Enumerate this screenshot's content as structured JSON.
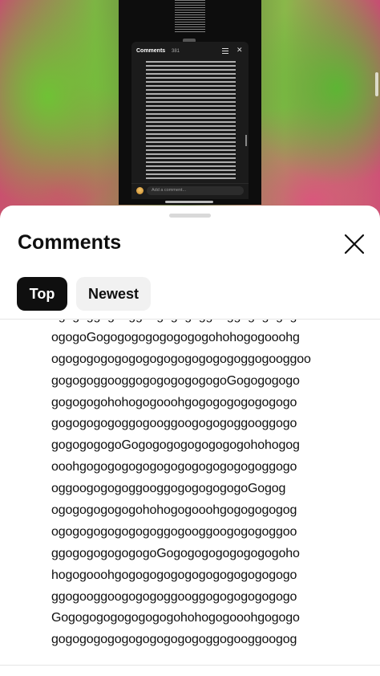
{
  "video": {
    "mini_sheet": {
      "title": "Comments",
      "count": "381",
      "input_placeholder": "Add a comment..."
    }
  },
  "sheet": {
    "title": "Comments",
    "tabs": [
      {
        "label": "Top",
        "selected": true
      },
      {
        "label": "Newest",
        "selected": false
      }
    ],
    "comment_lines": [
      "ogogoggogooggoogogogoggooggogogogog",
      "ogogoGogogogogogogogogohohogogooohg",
      "ogogogogogogogogogogogogogoggogooggoo",
      "gogogoggooggogogogogogogoGogogogogo",
      "gogogogohohogogooohgogogogogogogogo",
      "gogogogogoggogooggoogogogoggooggogo",
      "gogogogogoGogogogogogogogogohohogog",
      "ooohgogogogogogogogogogogogogoggogo",
      "oggoogogogoggooggogogogogogoGogog",
      "ogogogogogogohohogogooohgogogogogog",
      "ogogogogogogogoggogooggoogogogoggoo",
      "ggogogogogogogoGogogogogogogogogoho",
      "hogogooohgogogogogogogogogogogogogo",
      "ggogooggoogogogoggooggogogogogogogo",
      "Gogogogogogogogogohohogogooohgogogo",
      "gogogogogogogogogogogoggogooggoogog"
    ]
  },
  "colors": {
    "text": "#0f0f0f",
    "chip_selected_bg": "#0f0f0f",
    "chip_unselected_bg": "#f1f1f1"
  }
}
